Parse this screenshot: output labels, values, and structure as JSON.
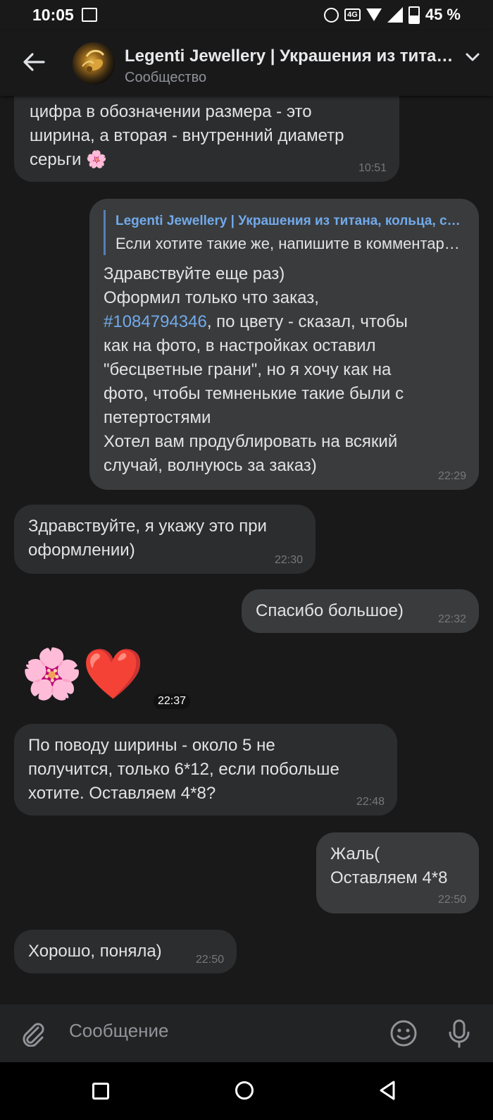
{
  "status_bar": {
    "time": "10:05",
    "battery": "45 %",
    "network": "4G"
  },
  "header": {
    "title": "Legenti Jewellery | Украшения из титана, кольца, серьги",
    "subtitle": "Сообщество"
  },
  "messages": [
    {
      "text": "цифра в обозначении размера - это\nширина, а вторая - внутренний диаметр\nсерьги 🌸",
      "time": "10:51"
    },
    {
      "reply_name": "Legenti Jewellery | Украшения из титана, кольца, серьги",
      "reply_text": "Если хотите такие же, напишите в комментариях",
      "line1": "Здравствуйте еще раз)\nОформил только что заказ,",
      "order_link": "#1084794346",
      "line2": ", по цвету - сказал, чтобы\nкак на фото, в настройках оставил\n\"бесцветные грани\", но я хочу как на\nфото, чтобы темненькие такие были с\nпетертостями\nХотел вам продублировать на всякий\nслучай, волнуюсь за заказ)",
      "time": "22:29"
    },
    {
      "text": "Здравствуйте, я укажу это при\nоформлении)",
      "time": "22:30"
    },
    {
      "text": "Спасибо большое)",
      "time": "22:32"
    },
    {
      "sticker": "🌸❤️",
      "time": "22:37"
    },
    {
      "text": "По поводу ширины - около 5 не\nполучится, только 6*12, если побольше\nхотите. Оставляем 4*8?",
      "time": "22:48"
    },
    {
      "text": "Жаль(\nОставляем 4*8",
      "time": "22:50"
    },
    {
      "text": "Хорошо, поняла)",
      "time": "22:50"
    }
  ],
  "composer": {
    "placeholder": "Сообщение"
  }
}
